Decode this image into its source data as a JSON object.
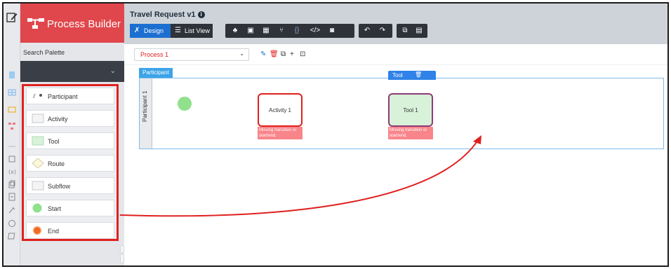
{
  "header": {
    "process_title": "Travel Request v1",
    "design_label": "Design",
    "list_view_label": "List View"
  },
  "brand": {
    "title": "Process Builder"
  },
  "palette": {
    "search_label": "Search Palette",
    "items": [
      {
        "label": "Participant",
        "icon": "participant-icon"
      },
      {
        "label": "Activity",
        "icon": "activity-icon"
      },
      {
        "label": "Tool",
        "icon": "tool-icon"
      },
      {
        "label": "Route",
        "icon": "route-diamond-icon"
      },
      {
        "label": "Subflow",
        "icon": "subflow-icon"
      },
      {
        "label": "Start",
        "icon": "start-circle-icon"
      },
      {
        "label": "End",
        "icon": "end-circle-icon"
      }
    ]
  },
  "process_bar": {
    "selected_process": "Process 1"
  },
  "canvas": {
    "participant_tab": "Participant",
    "lane_label": "Participant 1",
    "activity_label": "Activity 1",
    "tool_label": "Tool 1",
    "tool_tag": "Tool",
    "warning_text": "Missing transition or start/end."
  },
  "colors": {
    "brand_red": "#e0474c",
    "highlight_red": "#e0201e",
    "design_blue": "#1c6fd1",
    "start_green": "#90e08c",
    "end_orange": "#f26a21",
    "warning_pink": "#f8858a"
  }
}
